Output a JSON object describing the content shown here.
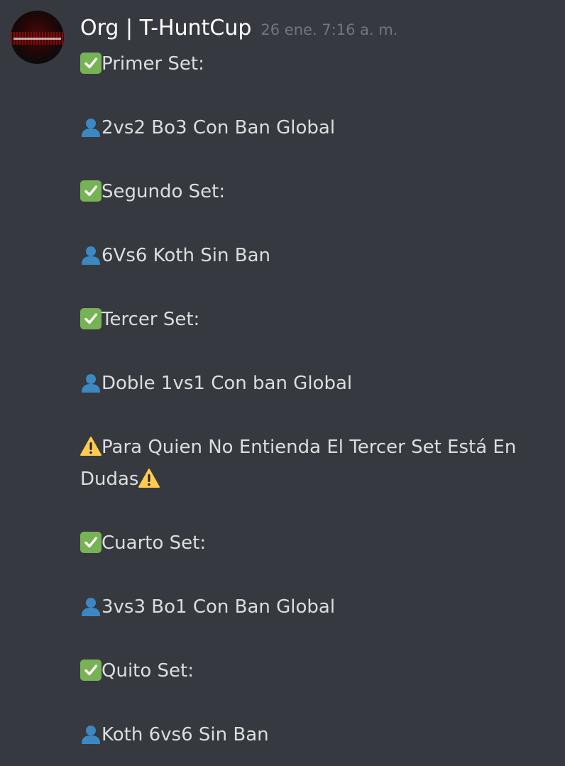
{
  "message": {
    "username": "Org | T-HuntCup",
    "timestamp": "26 ene. 7:16 a. m.",
    "lines": [
      {
        "emoji": "check-icon",
        "text": "Primer Set:"
      },
      {
        "emoji": "person-icon",
        "text": "2vs2 Bo3 Con Ban Global"
      },
      {
        "emoji": "check-icon",
        "text": "Segundo Set:"
      },
      {
        "emoji": "person-icon",
        "text": "6Vs6 Koth Sin Ban"
      },
      {
        "emoji": "check-icon",
        "text": "Tercer Set:"
      },
      {
        "emoji": "person-icon",
        "text": "Doble 1vs1 Con ban Global"
      },
      {
        "emoji": "warning-icon",
        "text": "Para Quien No Entienda El Tercer Set Está En Dudas"
      },
      {
        "emoji": "check-icon",
        "text": "Cuarto Set:"
      },
      {
        "emoji": "person-icon",
        "text": "3vs3 Bo1 Con Ban Global"
      },
      {
        "emoji": "check-icon",
        "text": "Quito Set:"
      },
      {
        "emoji": "person-icon",
        "text": "Koth 6vs6 Sin Ban"
      }
    ]
  },
  "colors": {
    "background": "#36393f",
    "text": "#dcddde",
    "username": "#ffffff",
    "timestamp": "#72767d",
    "check": "#77b255",
    "person": "#269",
    "warning": "#ffcc4d"
  }
}
